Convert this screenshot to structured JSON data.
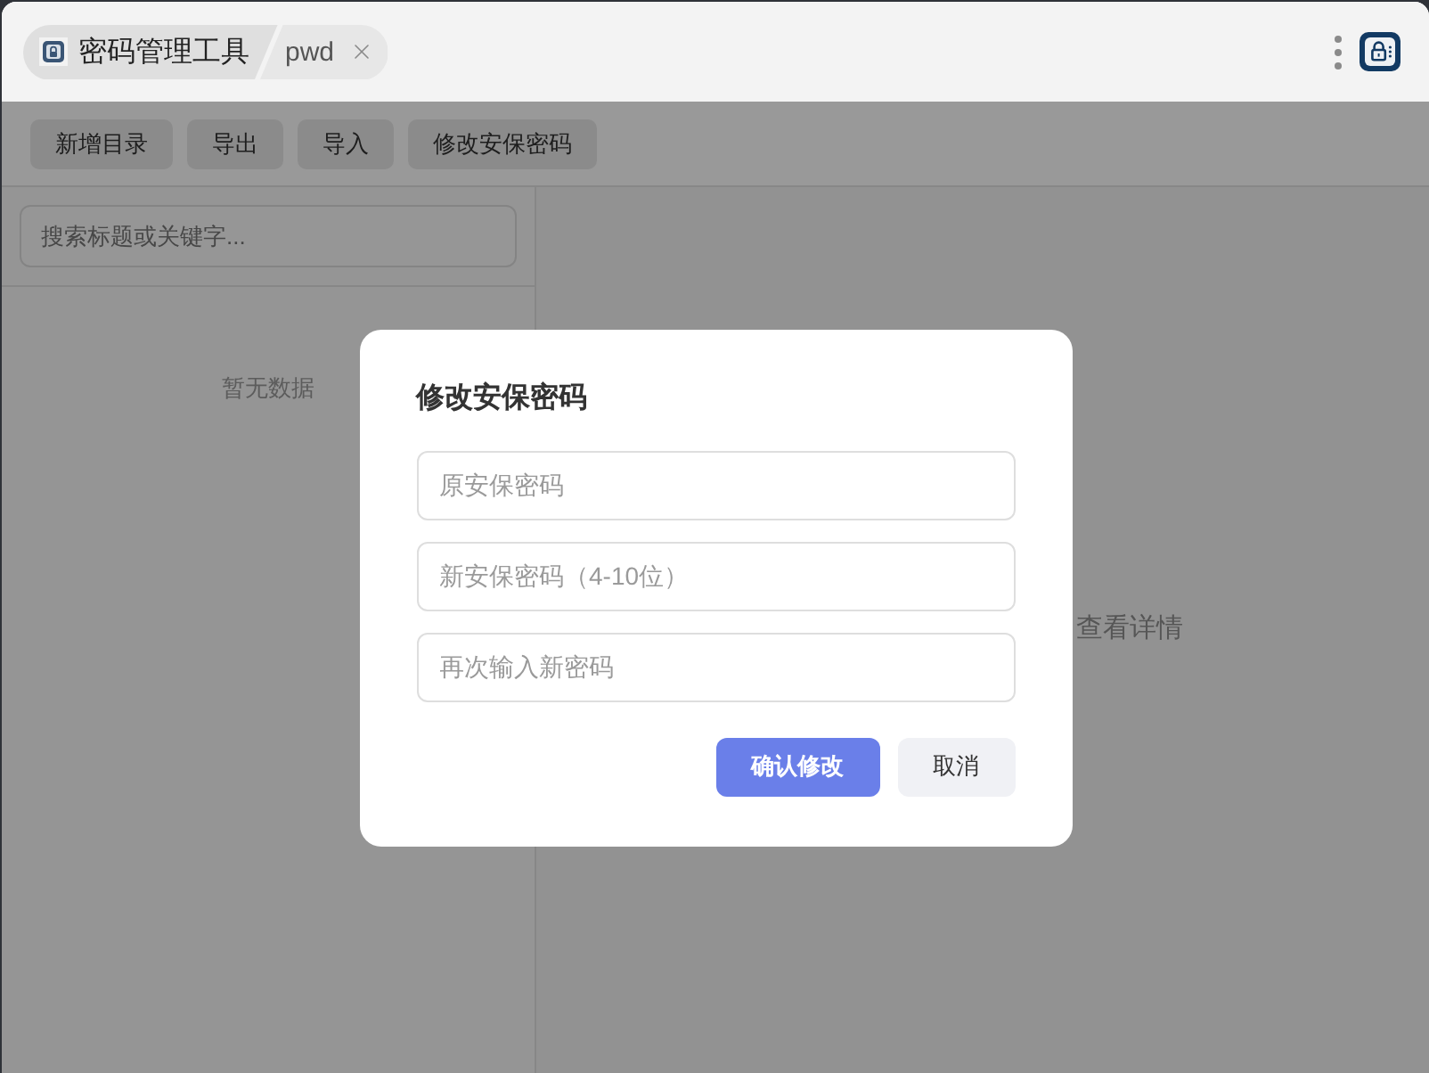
{
  "window": {
    "app_title": "密码管理工具",
    "tab": {
      "label": "pwd"
    }
  },
  "toolbar": {
    "buttons": [
      "新增目录",
      "导出",
      "导入",
      "修改安保密码"
    ]
  },
  "sidebar": {
    "search": {
      "placeholder": "搜索标题或关键字..."
    },
    "empty_text": "暂无数据"
  },
  "detail": {
    "hint": "查看详情"
  },
  "dialog": {
    "title": "修改安保密码",
    "fields": [
      {
        "placeholder": "原安保密码"
      },
      {
        "placeholder": "新安保密码（4-10位）"
      },
      {
        "placeholder": "再次输入新密码"
      }
    ],
    "buttons": [
      {
        "label": "确认修改",
        "kind": "primary"
      },
      {
        "label": "取消",
        "kind": "secondary"
      }
    ]
  }
}
